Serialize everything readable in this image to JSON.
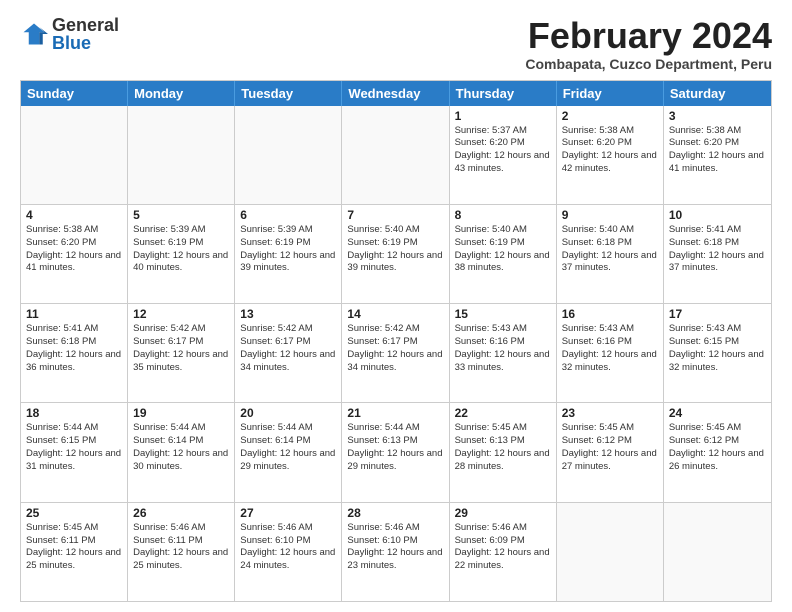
{
  "logo": {
    "general": "General",
    "blue": "Blue"
  },
  "title": "February 2024",
  "location": "Combapata, Cuzco Department, Peru",
  "days_of_week": [
    "Sunday",
    "Monday",
    "Tuesday",
    "Wednesday",
    "Thursday",
    "Friday",
    "Saturday"
  ],
  "weeks": [
    [
      {
        "day": "",
        "info": ""
      },
      {
        "day": "",
        "info": ""
      },
      {
        "day": "",
        "info": ""
      },
      {
        "day": "",
        "info": ""
      },
      {
        "day": "1",
        "info": "Sunrise: 5:37 AM\nSunset: 6:20 PM\nDaylight: 12 hours and 43 minutes."
      },
      {
        "day": "2",
        "info": "Sunrise: 5:38 AM\nSunset: 6:20 PM\nDaylight: 12 hours and 42 minutes."
      },
      {
        "day": "3",
        "info": "Sunrise: 5:38 AM\nSunset: 6:20 PM\nDaylight: 12 hours and 41 minutes."
      }
    ],
    [
      {
        "day": "4",
        "info": "Sunrise: 5:38 AM\nSunset: 6:20 PM\nDaylight: 12 hours and 41 minutes."
      },
      {
        "day": "5",
        "info": "Sunrise: 5:39 AM\nSunset: 6:19 PM\nDaylight: 12 hours and 40 minutes."
      },
      {
        "day": "6",
        "info": "Sunrise: 5:39 AM\nSunset: 6:19 PM\nDaylight: 12 hours and 39 minutes."
      },
      {
        "day": "7",
        "info": "Sunrise: 5:40 AM\nSunset: 6:19 PM\nDaylight: 12 hours and 39 minutes."
      },
      {
        "day": "8",
        "info": "Sunrise: 5:40 AM\nSunset: 6:19 PM\nDaylight: 12 hours and 38 minutes."
      },
      {
        "day": "9",
        "info": "Sunrise: 5:40 AM\nSunset: 6:18 PM\nDaylight: 12 hours and 37 minutes."
      },
      {
        "day": "10",
        "info": "Sunrise: 5:41 AM\nSunset: 6:18 PM\nDaylight: 12 hours and 37 minutes."
      }
    ],
    [
      {
        "day": "11",
        "info": "Sunrise: 5:41 AM\nSunset: 6:18 PM\nDaylight: 12 hours and 36 minutes."
      },
      {
        "day": "12",
        "info": "Sunrise: 5:42 AM\nSunset: 6:17 PM\nDaylight: 12 hours and 35 minutes."
      },
      {
        "day": "13",
        "info": "Sunrise: 5:42 AM\nSunset: 6:17 PM\nDaylight: 12 hours and 34 minutes."
      },
      {
        "day": "14",
        "info": "Sunrise: 5:42 AM\nSunset: 6:17 PM\nDaylight: 12 hours and 34 minutes."
      },
      {
        "day": "15",
        "info": "Sunrise: 5:43 AM\nSunset: 6:16 PM\nDaylight: 12 hours and 33 minutes."
      },
      {
        "day": "16",
        "info": "Sunrise: 5:43 AM\nSunset: 6:16 PM\nDaylight: 12 hours and 32 minutes."
      },
      {
        "day": "17",
        "info": "Sunrise: 5:43 AM\nSunset: 6:15 PM\nDaylight: 12 hours and 32 minutes."
      }
    ],
    [
      {
        "day": "18",
        "info": "Sunrise: 5:44 AM\nSunset: 6:15 PM\nDaylight: 12 hours and 31 minutes."
      },
      {
        "day": "19",
        "info": "Sunrise: 5:44 AM\nSunset: 6:14 PM\nDaylight: 12 hours and 30 minutes."
      },
      {
        "day": "20",
        "info": "Sunrise: 5:44 AM\nSunset: 6:14 PM\nDaylight: 12 hours and 29 minutes."
      },
      {
        "day": "21",
        "info": "Sunrise: 5:44 AM\nSunset: 6:13 PM\nDaylight: 12 hours and 29 minutes."
      },
      {
        "day": "22",
        "info": "Sunrise: 5:45 AM\nSunset: 6:13 PM\nDaylight: 12 hours and 28 minutes."
      },
      {
        "day": "23",
        "info": "Sunrise: 5:45 AM\nSunset: 6:12 PM\nDaylight: 12 hours and 27 minutes."
      },
      {
        "day": "24",
        "info": "Sunrise: 5:45 AM\nSunset: 6:12 PM\nDaylight: 12 hours and 26 minutes."
      }
    ],
    [
      {
        "day": "25",
        "info": "Sunrise: 5:45 AM\nSunset: 6:11 PM\nDaylight: 12 hours and 25 minutes."
      },
      {
        "day": "26",
        "info": "Sunrise: 5:46 AM\nSunset: 6:11 PM\nDaylight: 12 hours and 25 minutes."
      },
      {
        "day": "27",
        "info": "Sunrise: 5:46 AM\nSunset: 6:10 PM\nDaylight: 12 hours and 24 minutes."
      },
      {
        "day": "28",
        "info": "Sunrise: 5:46 AM\nSunset: 6:10 PM\nDaylight: 12 hours and 23 minutes."
      },
      {
        "day": "29",
        "info": "Sunrise: 5:46 AM\nSunset: 6:09 PM\nDaylight: 12 hours and 22 minutes."
      },
      {
        "day": "",
        "info": ""
      },
      {
        "day": "",
        "info": ""
      }
    ]
  ]
}
